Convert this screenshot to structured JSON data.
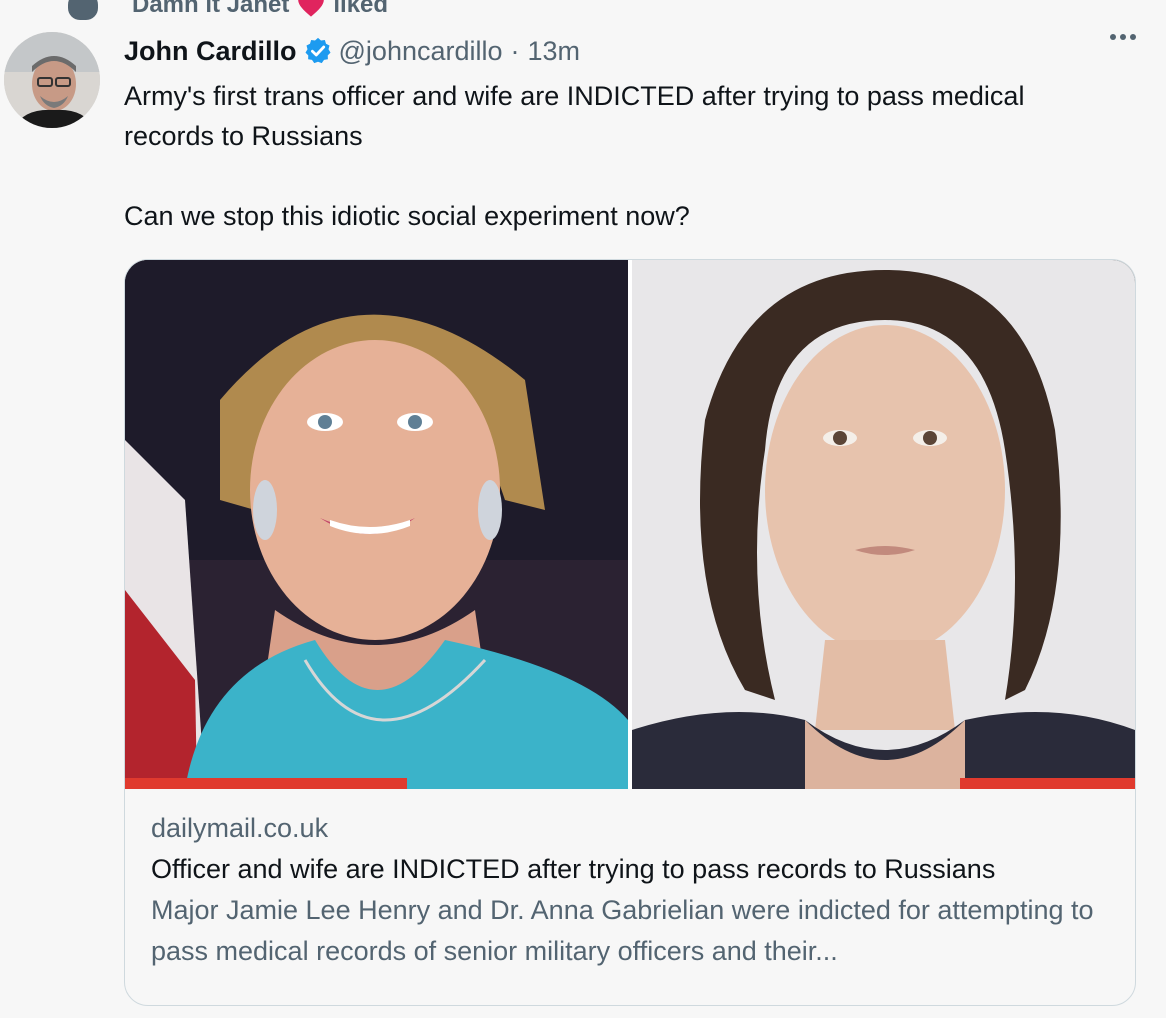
{
  "social_context": {
    "actor": "Damn it Janet",
    "action": "liked",
    "heart_color": "#e0245e"
  },
  "tweet": {
    "author_name": "John Cardillo",
    "author_handle": "@johncardillo",
    "separator": "·",
    "time": "13m",
    "verified_color": "#1d9bf0",
    "text": "Army's first trans officer and wife are INDICTED after trying to pass medical\nrecords to Russians\n\nCan we stop this idiotic social experiment now?",
    "more_icon": "more-horizontal-icon"
  },
  "card": {
    "domain": "dailymail.co.uk",
    "title": "Officer and wife are INDICTED after trying to pass records to Russians",
    "description": "Major Jamie Lee Henry and Dr. Anna Gabrielian were indicted for attempting to pass medical records of senior military officers and their..."
  }
}
